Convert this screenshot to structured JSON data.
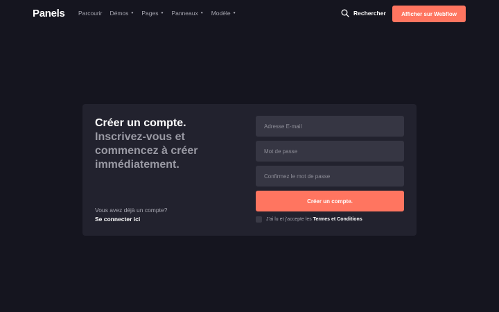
{
  "nav": {
    "logo": "Panels",
    "links": [
      {
        "label": "Parcourir",
        "dropdown": false
      },
      {
        "label": "Démos",
        "dropdown": true
      },
      {
        "label": "Pages",
        "dropdown": true
      },
      {
        "label": "Panneaux",
        "dropdown": true
      },
      {
        "label": "Modèle",
        "dropdown": true
      }
    ],
    "search_label": "Rechercher",
    "cta_label": "Afficher sur Webflow"
  },
  "signup": {
    "title": "Créer un compte.",
    "subtitle": "Inscrivez-vous et commencez à créer immédiatement.",
    "email_placeholder": "Adresse E-mail",
    "password_placeholder": "Mot de passe",
    "confirm_placeholder": "Confirmez le mot de passe",
    "submit_label": "Créer un compte.",
    "login_hint": "Vous avez déjà un compte?",
    "login_link": "Se connecter ici",
    "terms_prefix": "J'ai lu et j'accepte les",
    "terms_link": "Termes et Conditions"
  },
  "colors": {
    "background": "#15151f",
    "card": "#22222e",
    "field": "#363643",
    "accent": "#ff7560"
  }
}
